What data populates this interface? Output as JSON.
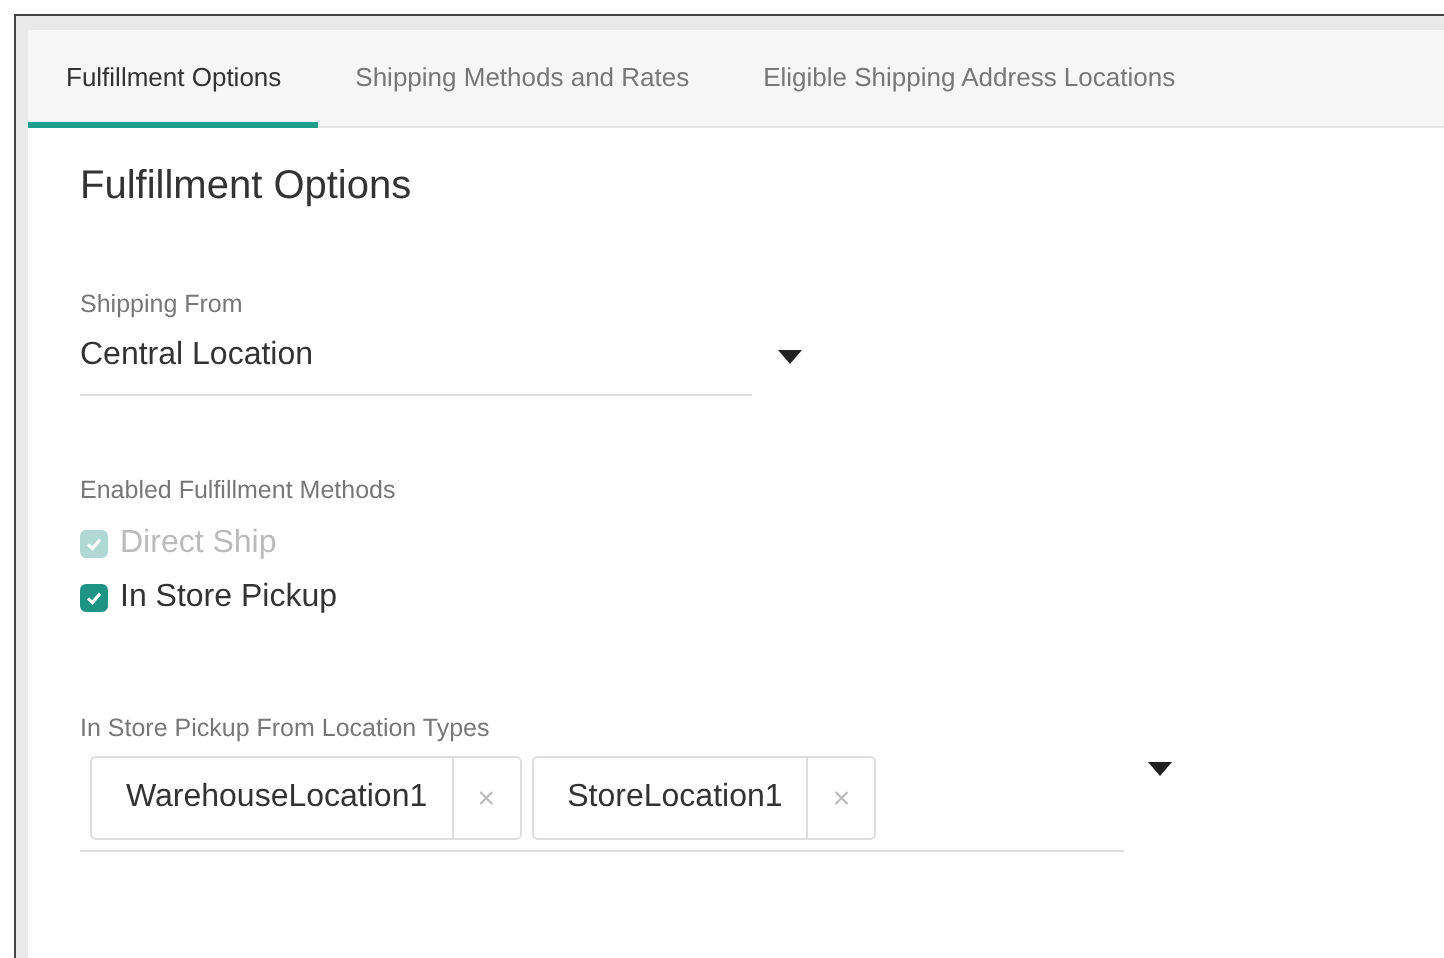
{
  "tabs": [
    {
      "label": "Fulfillment Options",
      "selected": true
    },
    {
      "label": "Shipping Methods and Rates",
      "selected": false
    },
    {
      "label": "Eligible Shipping Address Locations",
      "selected": false
    }
  ],
  "heading": "Fulfillment Options",
  "shipping_from": {
    "label": "Shipping From",
    "value": "Central Location"
  },
  "methods": {
    "label": "Enabled Fulfillment Methods",
    "items": [
      {
        "label": "Direct Ship",
        "checked": true,
        "disabled": true
      },
      {
        "label": "In Store Pickup",
        "checked": true,
        "disabled": false
      }
    ]
  },
  "pickup_types": {
    "label": "In Store Pickup From Location Types",
    "tags": [
      {
        "label": "WarehouseLocation1",
        "remove": "×"
      },
      {
        "label": "StoreLocation1",
        "remove": "×"
      }
    ]
  }
}
